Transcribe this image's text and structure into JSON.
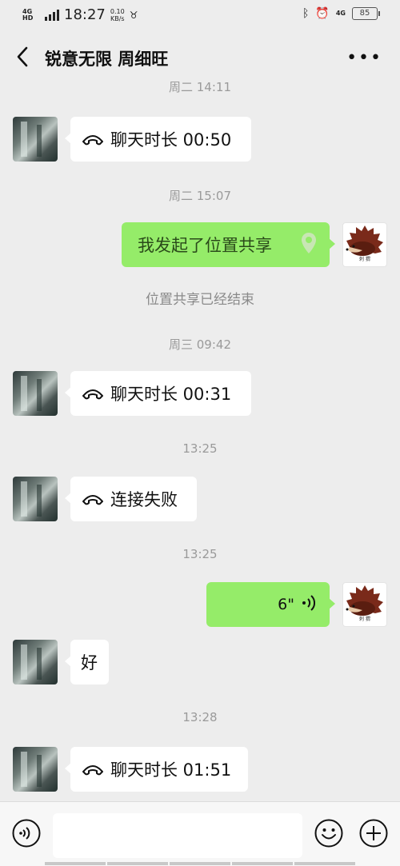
{
  "status_bar": {
    "network": "4G HD",
    "time": "18:27",
    "speed_value": "0.10",
    "speed_unit": "KB/s",
    "network_right": "4G",
    "battery": "85"
  },
  "header": {
    "title": "锐意无限 周细旺"
  },
  "messages": [
    {
      "kind": "timestamp",
      "text": "周二 14:11"
    },
    {
      "kind": "call",
      "side": "in",
      "text": "聊天时长 00:50"
    },
    {
      "kind": "timestamp",
      "text": "周二 15:07"
    },
    {
      "kind": "location",
      "side": "out",
      "text": "我发起了位置共享"
    },
    {
      "kind": "system",
      "text": "位置共享已经结束"
    },
    {
      "kind": "timestamp",
      "text": "周三 09:42"
    },
    {
      "kind": "call",
      "side": "in",
      "text": "聊天时长 00:31"
    },
    {
      "kind": "timestamp",
      "text": "13:25"
    },
    {
      "kind": "call",
      "side": "in",
      "text": "连接失败"
    },
    {
      "kind": "timestamp",
      "text": "13:25"
    },
    {
      "kind": "voice",
      "side": "out",
      "text": "6\""
    },
    {
      "kind": "text",
      "side": "in",
      "text": "好"
    },
    {
      "kind": "timestamp",
      "text": "13:28"
    },
    {
      "kind": "call",
      "side": "in",
      "text": "聊天时长 01:51"
    }
  ],
  "avatar_text": "刺 猬",
  "icons": {
    "back": "chevron-left-icon",
    "more": "more-dots-icon",
    "call": "phone-hangup-icon",
    "location": "location-pin-icon",
    "voice_msg": "voice-wave-icon",
    "voice_input": "voice-input-icon",
    "emoji": "emoji-icon",
    "plus": "plus-icon"
  },
  "colors": {
    "outgoing_bubble": "#95ec69",
    "incoming_bubble": "#ffffff",
    "background": "#ededed"
  }
}
